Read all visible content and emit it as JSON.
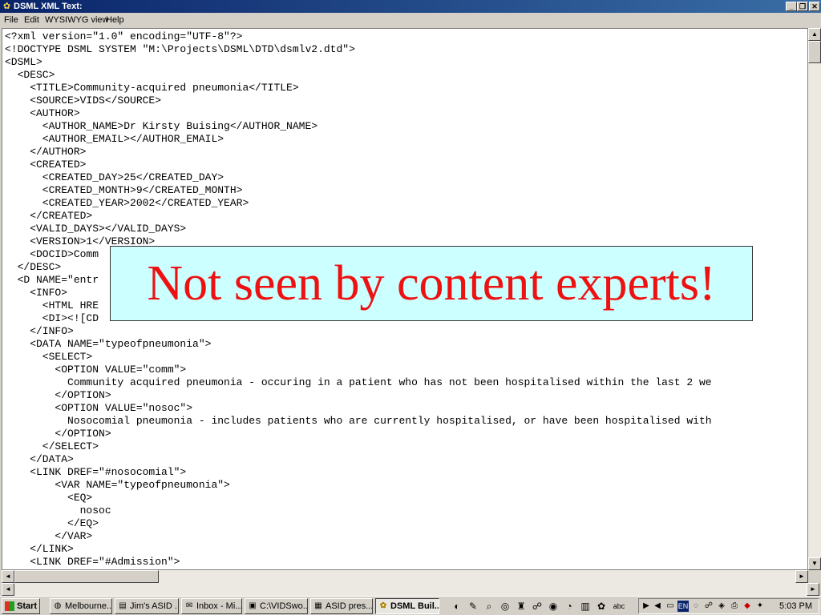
{
  "window": {
    "title": "DSML XML Text:",
    "controls": {
      "minimize": "_",
      "maximize": "❐",
      "close": "✕"
    }
  },
  "menu": [
    "File",
    "Edit",
    "WYSIWYG view",
    "Help"
  ],
  "editor": {
    "lines": [
      "<?xml version=\"1.0\" encoding=\"UTF-8\"?>",
      "<!DOCTYPE DSML SYSTEM \"M:\\Projects\\DSML\\DTD\\dsmlv2.dtd\">",
      "<DSML>",
      "  <DESC>",
      "    <TITLE>Community-acquired pneumonia</TITLE>",
      "    <SOURCE>VIDS</SOURCE>",
      "    <AUTHOR>",
      "      <AUTHOR_NAME>Dr Kirsty Buising</AUTHOR_NAME>",
      "      <AUTHOR_EMAIL></AUTHOR_EMAIL>",
      "    </AUTHOR>",
      "    <CREATED>",
      "      <CREATED_DAY>25</CREATED_DAY>",
      "      <CREATED_MONTH>9</CREATED_MONTH>",
      "      <CREATED_YEAR>2002</CREATED_YEAR>",
      "    </CREATED>",
      "    <VALID_DAYS></VALID_DAYS>",
      "    <VERSION>1</VERSION>",
      "    <DOCID>Comm",
      "  </DESC>",
      "  <D NAME=\"entr",
      "    <INFO>",
      "      <HTML HRE",
      "      <DI><![CD",
      "    </INFO>",
      "    <DATA NAME=\"typeofpneumonia\">",
      "      <SELECT>",
      "        <OPTION VALUE=\"comm\">",
      "          Community acquired pneumonia - occuring in a patient who has not been hospitalised within the last 2 we",
      "        </OPTION>",
      "        <OPTION VALUE=\"nosoc\">",
      "          Nosocomial pneumonia - includes patients who are currently hospitalised, or have been hospitalised with",
      "        </OPTION>",
      "      </SELECT>",
      "    </DATA>",
      "    <LINK DREF=\"#nosocomial\">",
      "        <VAR NAME=\"typeofpneumonia\">",
      "          <EQ>",
      "            nosoc",
      "          </EQ>",
      "        </VAR>",
      "    </LINK>",
      "    <LINK DREF=\"#Admission\">"
    ]
  },
  "callout": {
    "text": "Not seen by content experts!"
  },
  "scrollbars": {
    "up": "▲",
    "down": "▼",
    "left": "◄",
    "right": "►"
  },
  "taskbar": {
    "start_label": "Start",
    "tasks": [
      {
        "label": "Melbourne...",
        "icon": "browser-icon"
      },
      {
        "label": "Jim's ASID ...",
        "icon": "document-icon"
      },
      {
        "label": "Inbox - Mi...",
        "icon": "mail-icon"
      },
      {
        "label": "C:\\VIDSwo...",
        "icon": "folder-icon"
      },
      {
        "label": "ASID pres...",
        "icon": "presentation-icon"
      },
      {
        "label": "DSML Buil...",
        "icon": "app-icon"
      }
    ],
    "tray_lang": "EN",
    "clock": "5:03 PM"
  },
  "colors": {
    "callout_bg": "#ccffff",
    "callout_text": "#ee1111",
    "titlebar": "#0a246a"
  }
}
